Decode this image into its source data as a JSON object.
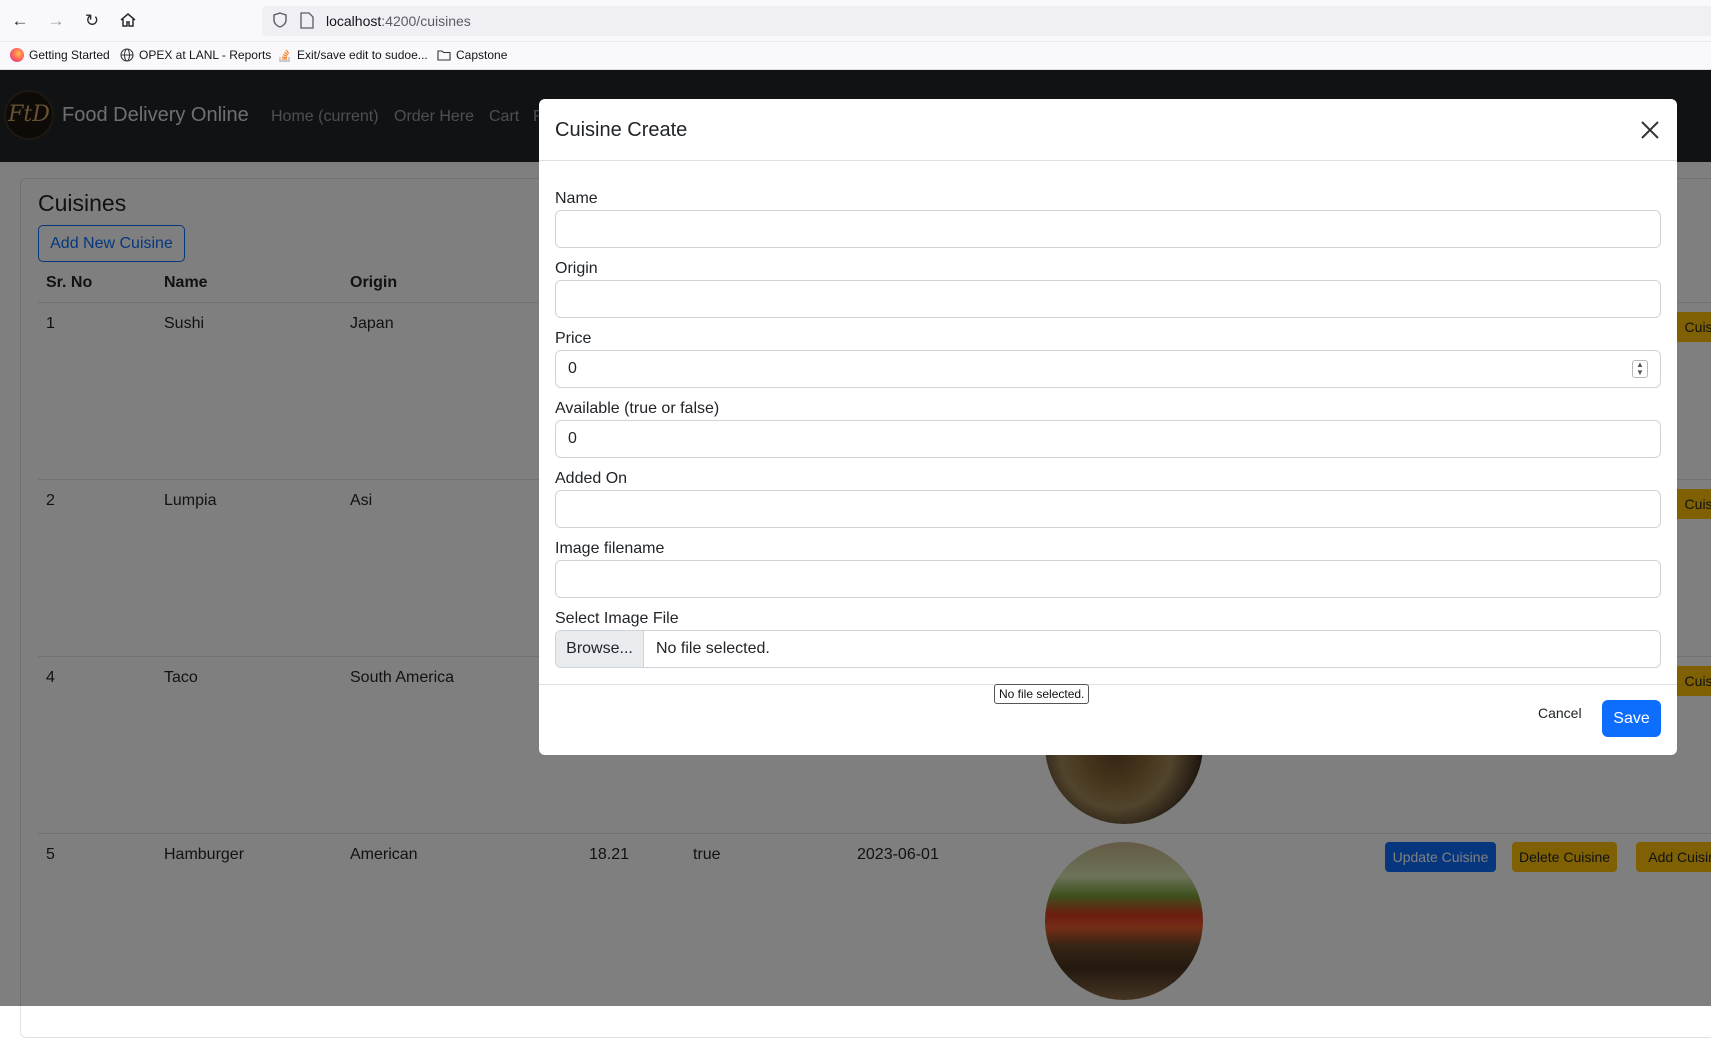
{
  "browser": {
    "url_host": "localhost",
    "url_path": ":4200/cuisines",
    "bookmarks": [
      "Getting Started",
      "OPEX at LANL - Reports",
      "Exit/save edit to sudoe...",
      "Capstone"
    ]
  },
  "navbar": {
    "brand": "Food Delivery Online",
    "logo_text": "FtD",
    "links": [
      "Home (current)",
      "Order Here",
      "Cart",
      "F"
    ]
  },
  "page": {
    "title": "Cuisines",
    "add_button": "Add New Cuisine",
    "columns": [
      "Sr. No",
      "Name",
      "Origin"
    ],
    "rows": [
      {
        "sr": "1",
        "name": "Sushi",
        "origin": "Japan"
      },
      {
        "sr": "2",
        "name": "Lumpia",
        "origin": "Asi"
      },
      {
        "sr": "4",
        "name": "Taco",
        "origin": "South America"
      },
      {
        "sr": "5",
        "name": "Hamburger",
        "origin": "American",
        "price": "18.21",
        "available": "true",
        "added_on": "2023-06-01"
      }
    ],
    "row_buttons": {
      "update": "Update Cuisine",
      "delete": "Delete Cuisine",
      "add": "Add Cuisine",
      "add_clipped": "Cuisin"
    }
  },
  "modal": {
    "title": "Cuisine Create",
    "fields": {
      "name": {
        "label": "Name",
        "value": ""
      },
      "origin": {
        "label": "Origin",
        "value": ""
      },
      "price": {
        "label": "Price",
        "value": "0"
      },
      "available": {
        "label": "Available (true or false)",
        "value": "0"
      },
      "added_on": {
        "label": "Added On",
        "value": ""
      },
      "image_filename": {
        "label": "Image filename",
        "value": ""
      }
    },
    "file": {
      "label": "Select Image File",
      "browse_label": "Browse...",
      "status": "No file selected."
    },
    "tooltip": "No file selected.",
    "cancel_label": "Cancel",
    "save_label": "Save"
  },
  "colors": {
    "primary": "#0d6efd",
    "warning": "#ffc107",
    "navbar": "#212529"
  }
}
